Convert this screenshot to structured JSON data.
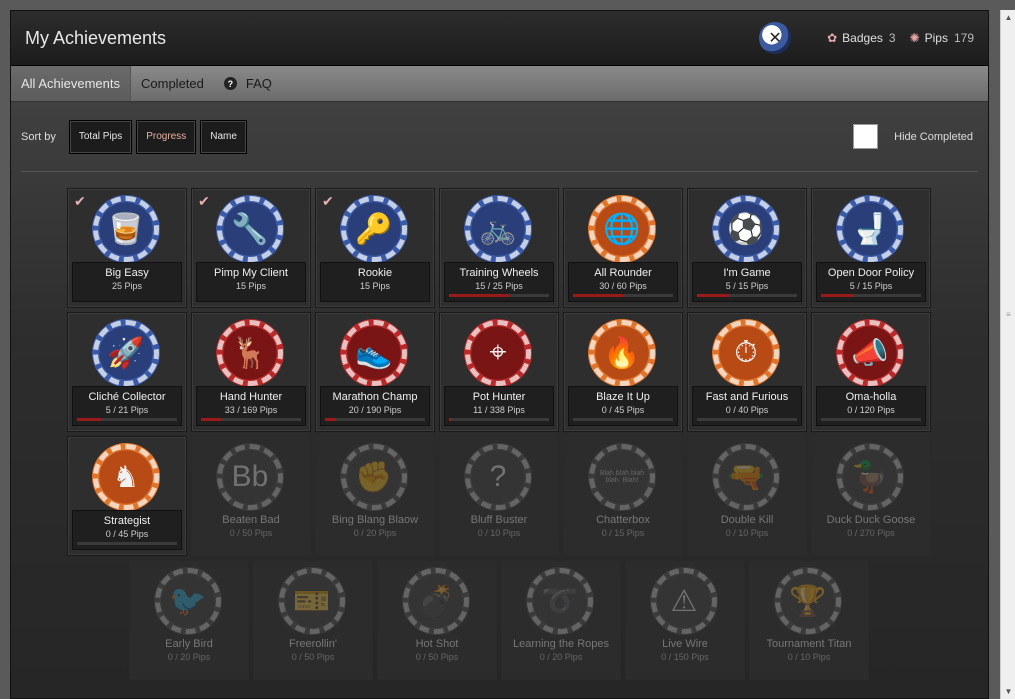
{
  "header": {
    "title": "My Achievements",
    "profile_icon": "wrench-screwdriver-icon",
    "badges_label": "Badges",
    "badges_count": "3",
    "pips_label": "Pips",
    "pips_count": "179"
  },
  "tabs": [
    {
      "label": "All Achievements",
      "active": true
    },
    {
      "label": "Completed",
      "active": false
    },
    {
      "label": "FAQ",
      "active": false
    }
  ],
  "sort": {
    "label": "Sort by",
    "buttons": [
      "Total Pips",
      "Progress",
      "Name"
    ],
    "hide_completed_label": "Hide Completed"
  },
  "accent": "#9a1a1a",
  "achievements": [
    {
      "name": "Big Easy",
      "pips": "25 Pips",
      "completed": true,
      "locked": false,
      "progress": 1,
      "chip": "blue",
      "icon": "glass-cigar-icon"
    },
    {
      "name": "Pimp My Client",
      "pips": "15 Pips",
      "completed": true,
      "locked": false,
      "progress": 1,
      "chip": "blue",
      "icon": "tools-icon"
    },
    {
      "name": "Rookie",
      "pips": "15 Pips",
      "completed": true,
      "locked": false,
      "progress": 1,
      "chip": "blue",
      "icon": "key-icon"
    },
    {
      "name": "Training Wheels",
      "pips": "15 / 25 Pips",
      "completed": false,
      "locked": false,
      "progress": 0.6,
      "chip": "blue",
      "icon": "tricycle-icon"
    },
    {
      "name": "All Rounder",
      "pips": "30 / 60 Pips",
      "completed": false,
      "locked": false,
      "progress": 0.5,
      "chip": "orange",
      "icon": "globe-icon"
    },
    {
      "name": "I'm Game",
      "pips": "5 / 15 Pips",
      "completed": false,
      "locked": false,
      "progress": 0.33,
      "chip": "blue",
      "icon": "soccer-ball-icon"
    },
    {
      "name": "Open Door Policy",
      "pips": "5 / 15 Pips",
      "completed": false,
      "locked": false,
      "progress": 0.33,
      "chip": "blue",
      "icon": "toilet-icon"
    },
    {
      "name": "Cliché Collector",
      "pips": "5 / 21 Pips",
      "completed": false,
      "locked": false,
      "progress": 0.24,
      "chip": "blue",
      "icon": "rocket-icon"
    },
    {
      "name": "Hand Hunter",
      "pips": "33 / 169 Pips",
      "completed": false,
      "locked": false,
      "progress": 0.2,
      "chip": "red",
      "icon": "deer-icon"
    },
    {
      "name": "Marathon Champ",
      "pips": "20 / 190 Pips",
      "completed": false,
      "locked": false,
      "progress": 0.11,
      "chip": "red",
      "icon": "sneaker-icon"
    },
    {
      "name": "Pot Hunter",
      "pips": "11 / 338 Pips",
      "completed": false,
      "locked": false,
      "progress": 0.03,
      "chip": "red",
      "icon": "crosshair-icon"
    },
    {
      "name": "Blaze It Up",
      "pips": "0 / 45 Pips",
      "completed": false,
      "locked": false,
      "progress": 0,
      "chip": "orange",
      "icon": "fire-icon"
    },
    {
      "name": "Fast and Furious",
      "pips": "0 / 40 Pips",
      "completed": false,
      "locked": false,
      "progress": 0,
      "chip": "orange",
      "icon": "stopwatch-icon"
    },
    {
      "name": "Oma-holla",
      "pips": "0 / 120 Pips",
      "completed": false,
      "locked": false,
      "progress": 0,
      "chip": "red",
      "icon": "megaphone-icon"
    },
    {
      "name": "Strategist",
      "pips": "0 / 45 Pips",
      "completed": false,
      "locked": false,
      "progress": 0,
      "chip": "orange",
      "icon": "chess-knight-icon"
    },
    {
      "name": "Beaten Bad",
      "pips": "0 / 50 Pips",
      "completed": false,
      "locked": true,
      "progress": 0,
      "chip": "grey",
      "icon": "bb-logo-icon"
    },
    {
      "name": "Bing Blang Blaow",
      "pips": "0 / 20 Pips",
      "completed": false,
      "locked": true,
      "progress": 0,
      "chip": "grey",
      "icon": "brass-knuckles-icon"
    },
    {
      "name": "Bluff Buster",
      "pips": "0 / 10 Pips",
      "completed": false,
      "locked": true,
      "progress": 0,
      "chip": "grey",
      "icon": "question-card-icon"
    },
    {
      "name": "Chatterbox",
      "pips": "0 / 15 Pips",
      "completed": false,
      "locked": true,
      "progress": 0,
      "chip": "grey",
      "icon": "speech-bubble-icon",
      "bubble_text": "Blah blah blah blah. Blah!"
    },
    {
      "name": "Double Kill",
      "pips": "0 / 10 Pips",
      "completed": false,
      "locked": true,
      "progress": 0,
      "chip": "grey",
      "icon": "gun-icon"
    },
    {
      "name": "Duck Duck Goose",
      "pips": "0 / 270 Pips",
      "completed": false,
      "locked": true,
      "progress": 0,
      "chip": "grey",
      "icon": "duck-icon"
    },
    {
      "name": "Early Bird",
      "pips": "0 / 20 Pips",
      "completed": false,
      "locked": true,
      "progress": 0,
      "chip": "grey",
      "icon": "bird-icon"
    },
    {
      "name": "Freerollin'",
      "pips": "0 / 50 Pips",
      "completed": false,
      "locked": true,
      "progress": 0,
      "chip": "grey",
      "icon": "ticket-icon"
    },
    {
      "name": "Hot Shot",
      "pips": "0 / 50 Pips",
      "completed": false,
      "locked": true,
      "progress": 0,
      "chip": "grey",
      "icon": "cannon-icon"
    },
    {
      "name": "Learning the Ropes",
      "pips": "0 / 20 Pips",
      "completed": false,
      "locked": true,
      "progress": 0,
      "chip": "grey",
      "icon": "rope-knot-icon"
    },
    {
      "name": "Live Wire",
      "pips": "0 / 150 Pips",
      "completed": false,
      "locked": true,
      "progress": 0,
      "chip": "grey",
      "icon": "warning-bolt-icon"
    },
    {
      "name": "Tournament Titan",
      "pips": "0 / 10 Pips",
      "completed": false,
      "locked": true,
      "progress": 0,
      "chip": "grey",
      "icon": "trophy-icon"
    }
  ]
}
